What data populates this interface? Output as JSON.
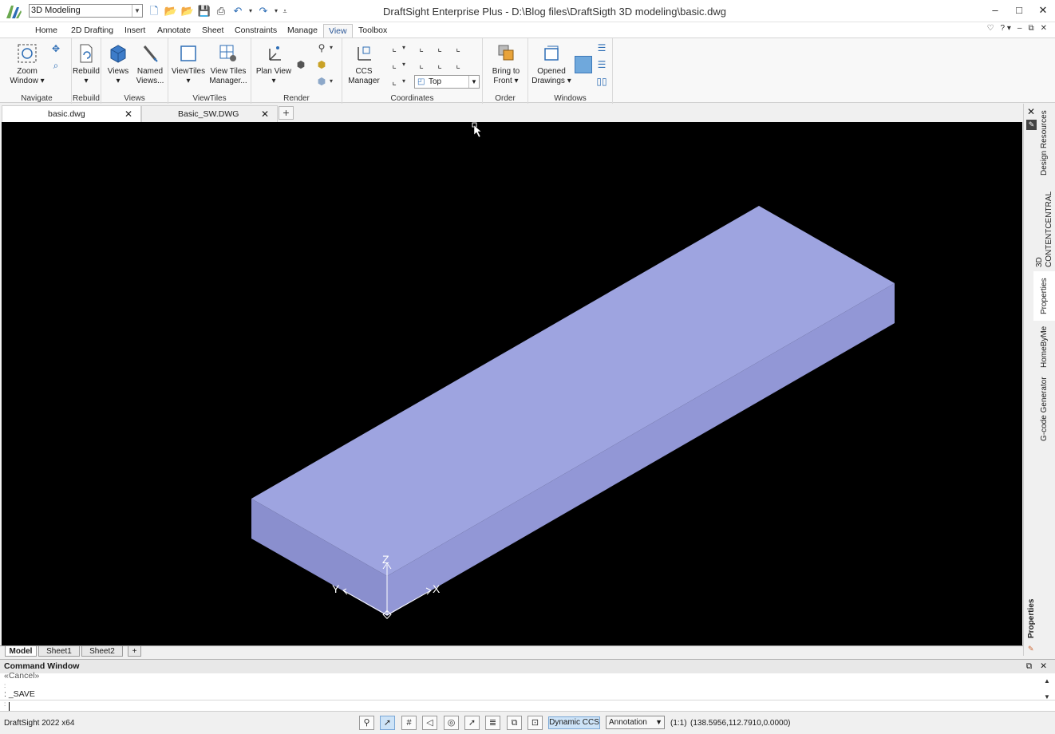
{
  "title_bar": {
    "workspace": "3D Modeling",
    "window_title": "DraftSight Enterprise Plus - D:\\Blog files\\DraftSigth 3D modeling\\basic.dwg",
    "minimize": "–",
    "restore": "□",
    "close": "✕"
  },
  "ribbon_tabs": [
    "Home",
    "2D Drafting",
    "Insert",
    "Annotate",
    "Sheet",
    "Constraints",
    "Manage",
    "View",
    "Toolbox"
  ],
  "ribbon_active_tab": "View",
  "ribbon": {
    "navigate": {
      "label": "Navigate",
      "zoom_window": "Zoom",
      "zoom_window2": "Window ▾"
    },
    "rebuild": {
      "label": "Rebuild",
      "rebuild_btn": "Rebuild",
      "rebuild_dd": "▾"
    },
    "views": {
      "label": "Views",
      "views_btn": "Views",
      "views_dd": "▾",
      "named": "Named",
      "named2": "Views..."
    },
    "viewtiles": {
      "label": "ViewTiles",
      "vt_btn": "ViewTiles",
      "vt_dd": "▾",
      "vt_mgr": "View Tiles",
      "vt_mgr2": "Manager..."
    },
    "render": {
      "label": "Render",
      "plan_view": "Plan View",
      "plan_dd": "▾"
    },
    "coordinates": {
      "label": "Coordinates",
      "ccs": "CCS",
      "ccs2": "Manager",
      "view_select": "Top"
    },
    "order": {
      "label": "Order",
      "bring": "Bring to",
      "bring2": "Front ▾"
    },
    "windows": {
      "label": "Windows",
      "opened": "Opened",
      "opened2": "Drawings ▾"
    }
  },
  "doc_tabs": [
    {
      "name": "basic.dwg",
      "active": true
    },
    {
      "name": "Basic_SW.DWG",
      "active": false
    }
  ],
  "side_tabs": [
    "Design Resources",
    "3D CONTENTCENTRAL",
    "Properties",
    "HomeByMe",
    "G-code Generator"
  ],
  "side_tab_bottom": "Properties",
  "sheet_tabs": [
    "Model",
    "Sheet1",
    "Sheet2"
  ],
  "axis_labels": {
    "z": "Z",
    "y": "Y",
    "x": "X"
  },
  "command_window": {
    "title": "Command Window",
    "lines": [
      "«Cancel»",
      ":",
      ": _SAVE",
      ":"
    ]
  },
  "status_bar": {
    "version": "DraftSight 2022 x64",
    "dynamic_ccs": "Dynamic CCS",
    "annotation": "Annotation",
    "scale": "(1:1)",
    "coords": "(138.5956,112.7910,0.0000)"
  },
  "colors": {
    "canvas_bg": "#000000",
    "box_top": "#9ea4e0",
    "box_front": "#8a8fce",
    "box_side": "#9297d6"
  }
}
